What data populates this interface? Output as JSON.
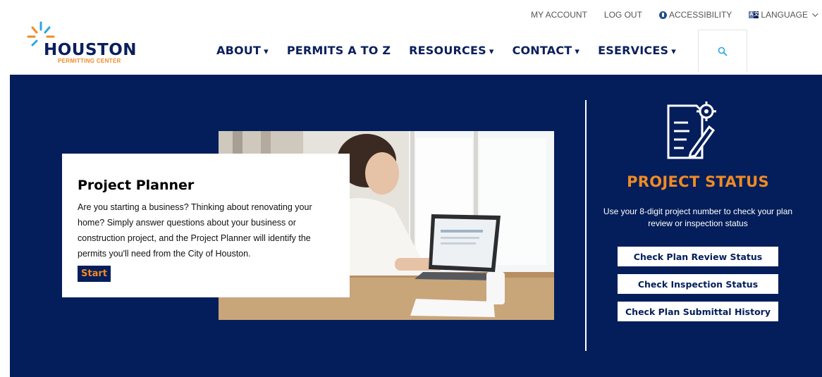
{
  "utility_nav": {
    "my_account": "MY ACCOUNT",
    "log_out": "LOG OUT",
    "accessibility": "ACCESSIBILITY",
    "language": "LANGUAGE"
  },
  "logo": {
    "name": "HOUSTON",
    "subtitle": "PERMITTING CENTER"
  },
  "main_nav": {
    "about": "ABOUT",
    "permits": "PERMITS A TO Z",
    "resources": "RESOURCES",
    "contact": "CONTACT",
    "eservices": "ESERVICES",
    "caret": "▾"
  },
  "icons": {
    "search": "search-icon",
    "accessibility": "accessibility-icon",
    "language": "language-icon",
    "project_status": "document-gear-icon"
  },
  "planner": {
    "title": "Project Planner",
    "description": "Are you starting a business? Thinking about renovating your home? Simply answer questions about your business or construction project, and the Project Planner will identify the permits you'll need from the City of Houston.",
    "start_label": "Start"
  },
  "status": {
    "title": "PROJECT STATUS",
    "description": "Use your 8-digit project number to check your plan review or inspection status",
    "buttons": [
      "Check Plan Review Status",
      "Check Inspection Status",
      "Check Plan Submittal History"
    ]
  },
  "colors": {
    "navy": "#031e5a",
    "orange": "#f08a24",
    "white": "#ffffff"
  }
}
